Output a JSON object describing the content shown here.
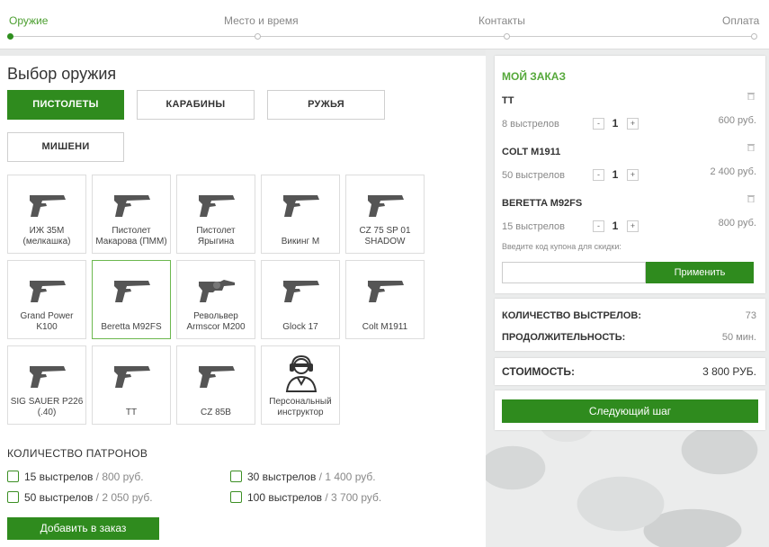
{
  "steps": [
    {
      "label": "Оружие",
      "active": true
    },
    {
      "label": "Место и время",
      "active": false
    },
    {
      "label": "Контакты",
      "active": false
    },
    {
      "label": "Оплата",
      "active": false
    }
  ],
  "weapon_section": {
    "title": "Выбор оружия",
    "categories": [
      "ПИСТОЛЕТЫ",
      "КАРАБИНЫ",
      "РУЖЬЯ",
      "МИШЕНИ"
    ],
    "active_category": "ПИСТОЛЕТЫ"
  },
  "weapons": [
    {
      "label": "ИЖ 35М (мелкашка)",
      "icon": "pistol-icon"
    },
    {
      "label": "Пистолет Макарова (ПММ)",
      "icon": "pistol-icon"
    },
    {
      "label": "Пистолет Ярыгина",
      "icon": "pistol-icon"
    },
    {
      "label": "Викинг М",
      "icon": "pistol-icon"
    },
    {
      "label": "CZ 75 SP 01 SHADOW",
      "icon": "pistol-icon"
    },
    {
      "label": "Grand Power K100",
      "icon": "pistol-icon"
    },
    {
      "label": "Beretta M92FS",
      "icon": "pistol-icon",
      "selected": true
    },
    {
      "label": "Револьвер Armscor M200",
      "icon": "revolver-icon"
    },
    {
      "label": "Glock 17",
      "icon": "pistol-icon"
    },
    {
      "label": "Colt M1911",
      "icon": "pistol-icon"
    },
    {
      "label": "SIG SAUER P226 (.40)",
      "icon": "pistol-icon"
    },
    {
      "label": "ТТ",
      "icon": "pistol-icon"
    },
    {
      "label": "CZ 85B",
      "icon": "pistol-icon"
    },
    {
      "label": "Персональный инструктор",
      "icon": "instructor-icon"
    }
  ],
  "ammo": {
    "title": "КОЛИЧЕСТВО ПАТРОНОВ",
    "options": [
      {
        "shots": "15 выстрелов",
        "price": "800 руб."
      },
      {
        "shots": "30 выстрелов",
        "price": "1 400 руб."
      },
      {
        "shots": "50 выстрелов",
        "price": "2 050 руб."
      },
      {
        "shots": "100 выстрелов",
        "price": "3 700 руб."
      }
    ],
    "separator": " / ",
    "add_button": "Добавить в заказ"
  },
  "order": {
    "title": "МОЙ ЗАКАЗ",
    "items": [
      {
        "name": "ТТ",
        "shots": "8 выстрелов",
        "qty": "1",
        "price": "600 руб."
      },
      {
        "name": "COLT M1911",
        "shots": "50 выстрелов",
        "qty": "1",
        "price": "2 400 руб."
      },
      {
        "name": "BERETTA M92FS",
        "shots": "15 выстрелов",
        "qty": "1",
        "price": "800 руб."
      }
    ],
    "minus": "-",
    "plus": "+",
    "coupon_hint": "Введите код купона для скидки:",
    "coupon_value": "",
    "apply_button": "Применить"
  },
  "summary": {
    "shots_label": "КОЛИЧЕСТВО ВЫСТРЕЛОВ:",
    "shots_value": "73",
    "duration_label": "ПРОДОЛЖИТЕЛЬНОСТЬ:",
    "duration_value": "50 мин."
  },
  "cost": {
    "label": "СТОИМОСТЬ:",
    "value": "3 800 РУБ."
  },
  "next_button": "Следующий шаг",
  "colors": {
    "accent": "#2f8b1e",
    "accent_text": "#55a83a"
  }
}
